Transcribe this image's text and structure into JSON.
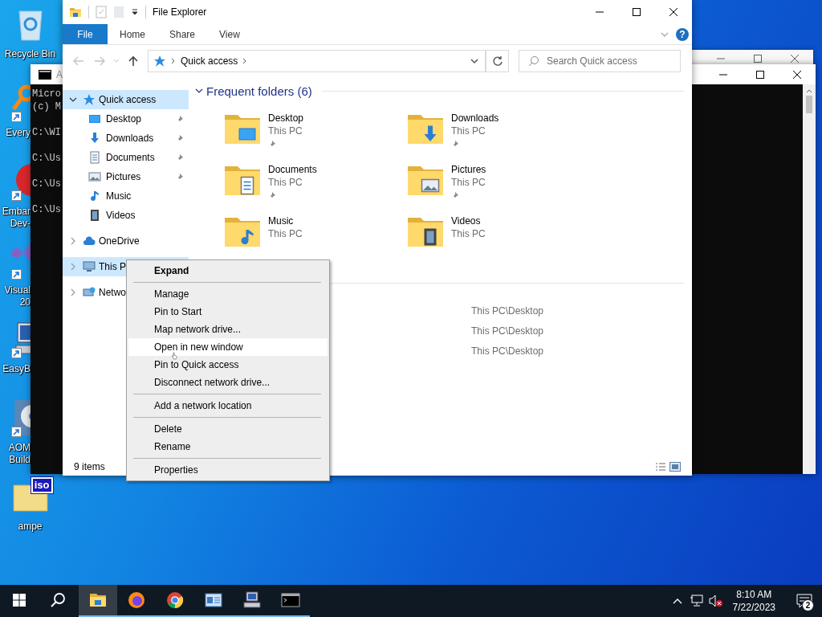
{
  "desktop_icons": [
    {
      "kind": "recycle",
      "shortcut": false,
      "lines": [
        "Recycle Bin"
      ]
    },
    {
      "kind": "magnifier",
      "shortcut": true,
      "lines": [
        "Every"
      ]
    },
    {
      "kind": "red-logo",
      "shortcut": true,
      "lines": [
        "Embar",
        "Dev-"
      ]
    },
    {
      "kind": "purple-logo",
      "shortcut": true,
      "lines": [
        "Visual",
        "20"
      ]
    },
    {
      "kind": "computer",
      "shortcut": true,
      "lines": [
        "EasyB"
      ]
    },
    {
      "kind": "disc",
      "shortcut": true,
      "lines": [
        "AOM",
        "Build"
      ]
    },
    {
      "kind": "disc-image",
      "shortcut": false,
      "badge": "iso",
      "lines": [
        "ampe"
      ]
    }
  ],
  "console": {
    "title": "A",
    "lines": [
      "Micro",
      "(c) M",
      "C:\\WI",
      "C:\\Us",
      "C:\\Us",
      "C:\\Us"
    ]
  },
  "explorer": {
    "title": "File Explorer",
    "ribbon_tabs": [
      {
        "label": "File",
        "kind": "file"
      },
      {
        "label": "Home",
        "kind": "tab"
      },
      {
        "label": "Share",
        "kind": "tab"
      },
      {
        "label": "View",
        "kind": "tab"
      }
    ],
    "help": "?",
    "address": {
      "crumbs": [
        "Quick access"
      ]
    },
    "search": {
      "placeholder": "Search Quick access"
    },
    "nav": [
      {
        "label": "Quick access",
        "kind": "star",
        "expanded": true,
        "selected": true,
        "children": [
          {
            "label": "Desktop",
            "kind": "desktop",
            "pinned": true
          },
          {
            "label": "Downloads",
            "kind": "download",
            "pinned": true
          },
          {
            "label": "Documents",
            "kind": "documents",
            "pinned": true
          },
          {
            "label": "Pictures",
            "kind": "pictures",
            "pinned": true
          },
          {
            "label": "Music",
            "kind": "music",
            "pinned": false
          },
          {
            "label": "Videos",
            "kind": "videos",
            "pinned": false
          }
        ]
      },
      {
        "label": "OneDrive",
        "kind": "cloud",
        "expanded": false,
        "selected": false
      },
      {
        "label": "This P",
        "kind": "computer",
        "expanded": false,
        "selected": true
      },
      {
        "label": "Netwo",
        "kind": "network",
        "expanded": false,
        "selected": false
      }
    ],
    "frequent": {
      "title": "Frequent folders (6)",
      "expanded": true,
      "folders": [
        {
          "name": "Desktop",
          "location": "This PC",
          "kind": "desktop",
          "pinned": true
        },
        {
          "name": "Downloads",
          "location": "This PC",
          "kind": "download",
          "pinned": true
        },
        {
          "name": "Documents",
          "location": "This PC",
          "kind": "documents",
          "pinned": true
        },
        {
          "name": "Pictures",
          "location": "This PC",
          "kind": "pictures",
          "pinned": true
        },
        {
          "name": "Music",
          "location": "This PC",
          "kind": "music",
          "pinned": false
        },
        {
          "name": "Videos",
          "location": "This PC",
          "kind": "videos",
          "pinned": false
        }
      ]
    },
    "recent": {
      "rows": [
        {
          "location": "This PC\\Desktop"
        },
        {
          "location": "This PC\\Desktop"
        },
        {
          "location": "This PC\\Desktop"
        }
      ]
    },
    "status": "9 items"
  },
  "context_menu": {
    "items": [
      {
        "kind": "item",
        "label": "Expand",
        "bold": true,
        "selected": false
      },
      {
        "kind": "separator"
      },
      {
        "kind": "item",
        "label": "Manage",
        "bold": false,
        "selected": false
      },
      {
        "kind": "item",
        "label": "Pin to Start",
        "bold": false,
        "selected": false
      },
      {
        "kind": "item",
        "label": "Map network drive...",
        "bold": false,
        "selected": false
      },
      {
        "kind": "item",
        "label": "Open in new window",
        "bold": false,
        "selected": true
      },
      {
        "kind": "item",
        "label": "Pin to Quick access",
        "bold": false,
        "selected": false
      },
      {
        "kind": "item",
        "label": "Disconnect network drive...",
        "bold": false,
        "selected": false
      },
      {
        "kind": "separator"
      },
      {
        "kind": "item",
        "label": "Add a network location",
        "bold": false,
        "selected": false
      },
      {
        "kind": "separator"
      },
      {
        "kind": "item",
        "label": "Delete",
        "bold": false,
        "selected": false
      },
      {
        "kind": "item",
        "label": "Rename",
        "bold": false,
        "selected": false
      },
      {
        "kind": "separator"
      },
      {
        "kind": "item",
        "label": "Properties",
        "bold": false,
        "selected": false
      }
    ]
  },
  "taskbar": {
    "apps": [
      {
        "kind": "explorer",
        "running": true,
        "selected": true
      },
      {
        "kind": "firefox",
        "running": true,
        "selected": false
      },
      {
        "kind": "chrome",
        "running": true,
        "selected": false
      },
      {
        "kind": "panel",
        "running": true,
        "selected": false
      },
      {
        "kind": "computer",
        "running": true,
        "selected": false
      },
      {
        "kind": "terminal",
        "running": true,
        "selected": false
      }
    ],
    "volume_muted": true,
    "time": "8:10 AM",
    "date": "7/22/2023",
    "notifications": "2"
  }
}
